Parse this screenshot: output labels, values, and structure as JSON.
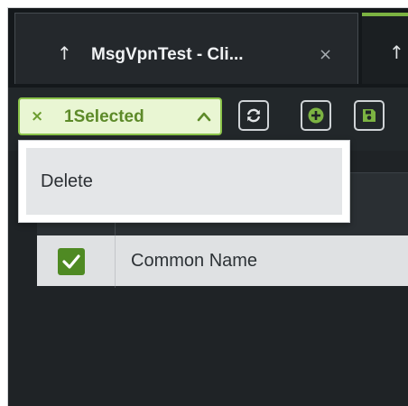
{
  "tabs": [
    {
      "title": "MsgVpnTest - Cli...",
      "arrow_glyph": "↑",
      "close_glyph": "×",
      "active": true
    },
    {
      "title": "",
      "arrow_glyph": "↑",
      "active": false
    }
  ],
  "toolbar": {
    "selection": {
      "clear_glyph": "×",
      "label": "1Selected",
      "chevron": "chevron-up-icon"
    },
    "buttons": [
      {
        "icon": "refresh-icon"
      },
      {
        "icon": "add-icon"
      },
      {
        "icon": "save-icon"
      }
    ]
  },
  "menu": {
    "items": [
      {
        "label": "Delete"
      }
    ]
  },
  "grid": {
    "rows": [
      {
        "checked": true,
        "name": "Common Name"
      }
    ]
  },
  "colors": {
    "accent_green": "#8bc34a",
    "dark_green": "#4f8a23",
    "background": "#1f2326"
  }
}
